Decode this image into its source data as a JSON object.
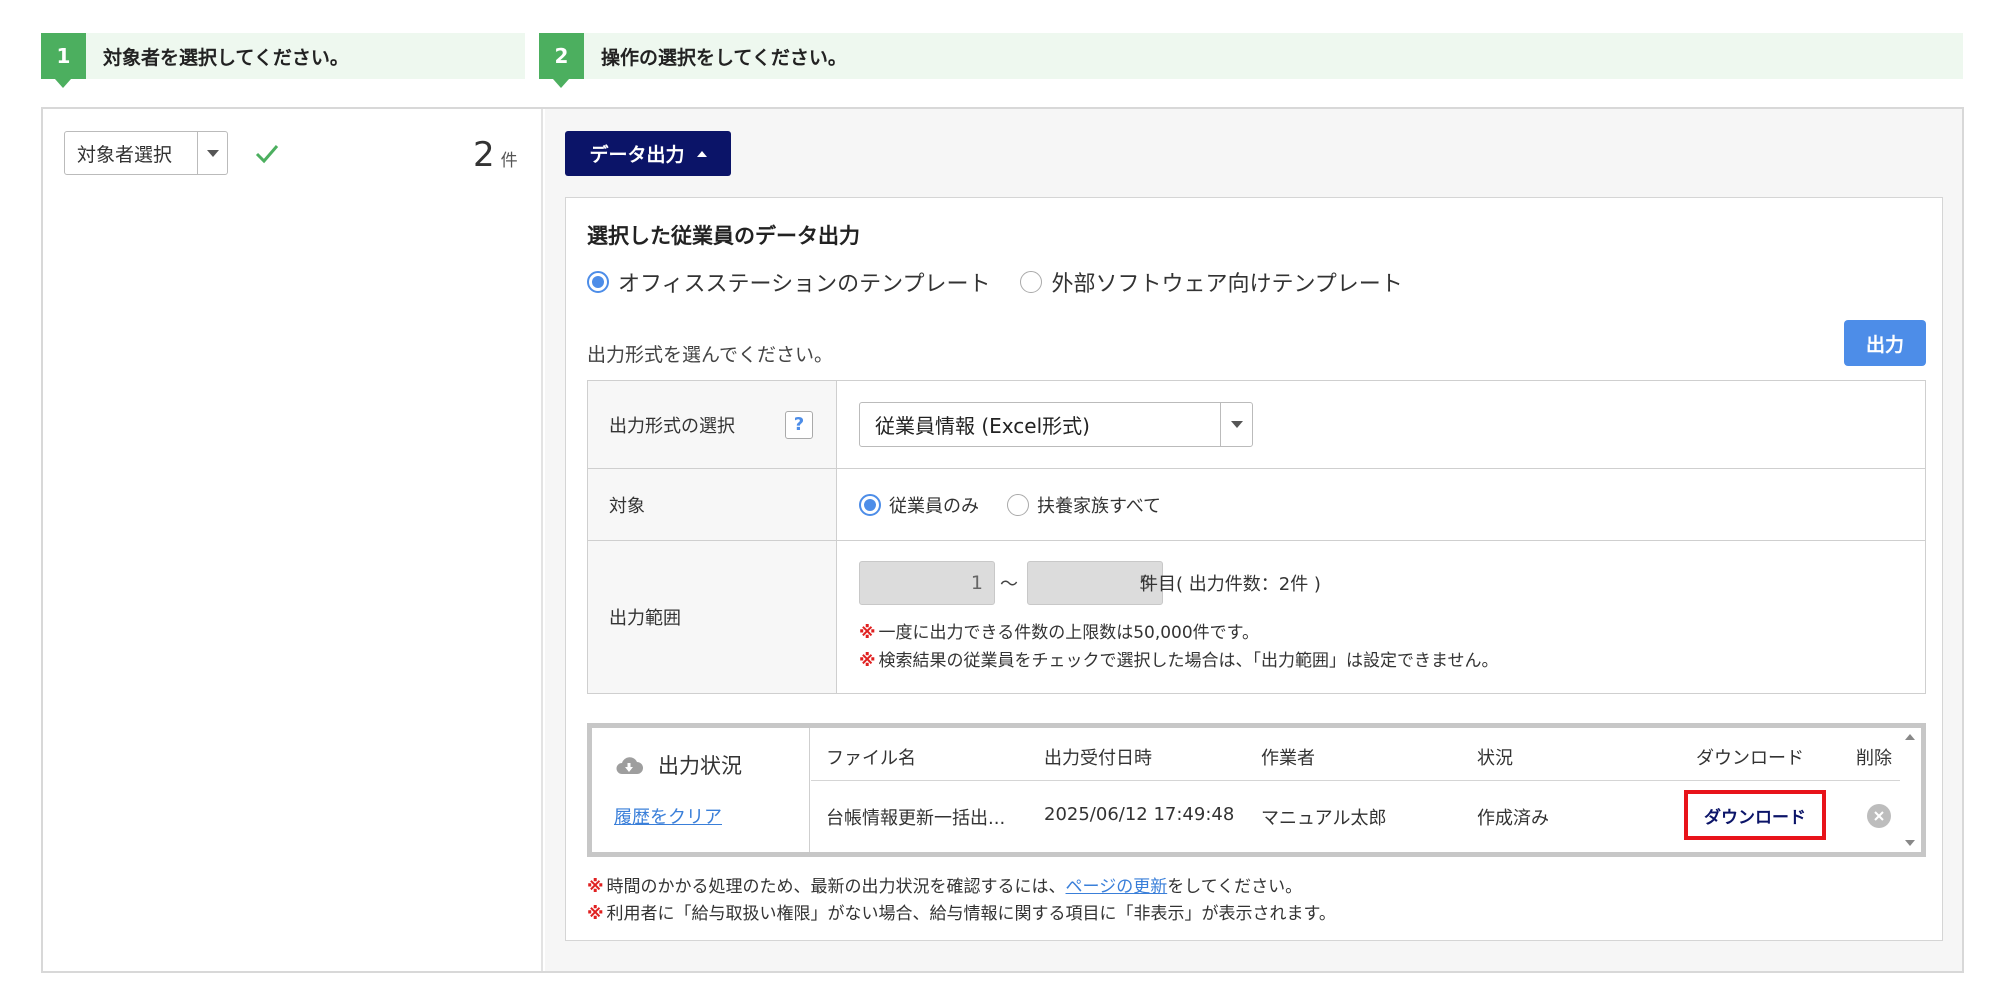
{
  "steps": [
    {
      "num": "1",
      "label": "対象者を選択してください。"
    },
    {
      "num": "2",
      "label": "操作の選択をしてください。"
    }
  ],
  "left": {
    "select_label": "対象者選択",
    "count_value": "2",
    "count_unit": "件"
  },
  "toolbar": {
    "data_output_label": "データ出力"
  },
  "panel": {
    "title": "選択した従業員のデータ出力",
    "template_options": [
      {
        "label": "オフィスステーションのテンプレート",
        "selected": true
      },
      {
        "label": "外部ソフトウェア向けテンプレート",
        "selected": false
      }
    ],
    "hint": "出力形式を選んでください。",
    "output_button": "出力",
    "form": {
      "format_label": "出力形式の選択",
      "format_help": "?",
      "format_value": "従業員情報 (Excel形式)",
      "target_label": "対象",
      "target_options": [
        {
          "label": "従業員のみ",
          "selected": true
        },
        {
          "label": "扶養家族すべて",
          "selected": false
        }
      ],
      "range_label": "出力範囲",
      "range_from": "1",
      "range_sep": "～",
      "range_to": "5",
      "range_suffix": "件目( 出力件数：2件 )",
      "note_mark": "※",
      "note1": "一度に出力できる件数の上限数は50,000件です。",
      "note2": "検索結果の従業員をチェックで選択した場合は、「出力範囲」は設定できません。"
    },
    "status": {
      "title": "出力状況",
      "clear_link": "履歴をクリア",
      "headers": {
        "file": "ファイル名",
        "date": "出力受付日時",
        "worker": "作業者",
        "state": "状況",
        "download": "ダウンロード",
        "delete": "削除"
      },
      "row": {
        "file": "台帳情報更新一括出...",
        "date": "2025/06/12 17:49:48",
        "worker": "マニュアル太郎",
        "state": "作成済み",
        "download_button": "ダウンロード"
      }
    },
    "footer": {
      "mark": "※",
      "note1_before": "時間のかかる処理のため、最新の出力状況を確認するには、",
      "note1_link": "ページの更新",
      "note1_after": "をしてください。",
      "note2": "利用者に「給与取扱い権限」がない場合、給与情報に関する項目に「非表示」が表示されます。"
    }
  },
  "colors": {
    "step_green": "#4caf5f",
    "navy_button": "#0b1468",
    "blue_button": "#4d8de8",
    "highlight_red": "#e8131a"
  }
}
